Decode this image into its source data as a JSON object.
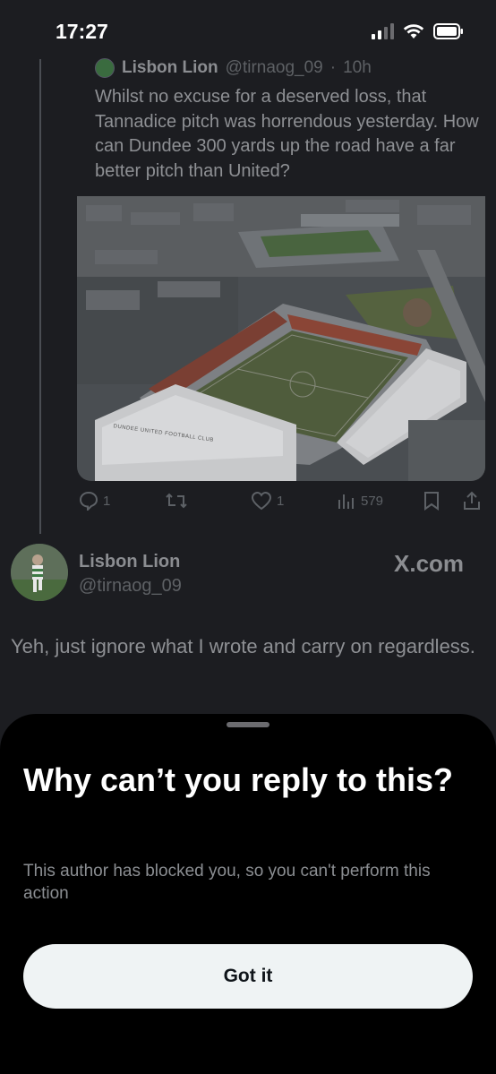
{
  "status_bar": {
    "time": "17:27"
  },
  "quoted_tweet": {
    "author_name": "Lisbon Lion",
    "author_handle": "@tirnaog_09",
    "time_ago": "10h",
    "text": "Whilst no excuse for a deserved loss, that Tannadice pitch was horrendous yesterday. How can Dundee 300 yards up the road have a far better pitch than United?",
    "stadium_sign": "DUNDEE UNITED FOOTBALL CLUB"
  },
  "actions": {
    "replies": "1",
    "likes": "1",
    "views": "579"
  },
  "reply": {
    "author_name": "Lisbon Lion",
    "author_handle": "@tirnaog_09",
    "source_badge": "X.com",
    "text": "Yeh, just ignore what I wrote and carry on regardless."
  },
  "sheet": {
    "title": "Why can’t you reply to this?",
    "body": "This author has blocked you, so you can't perform this action",
    "button_label": "Got it"
  },
  "colors": {
    "background": "#1c1d21",
    "sheet": "#000000",
    "button": "#eff3f4"
  }
}
